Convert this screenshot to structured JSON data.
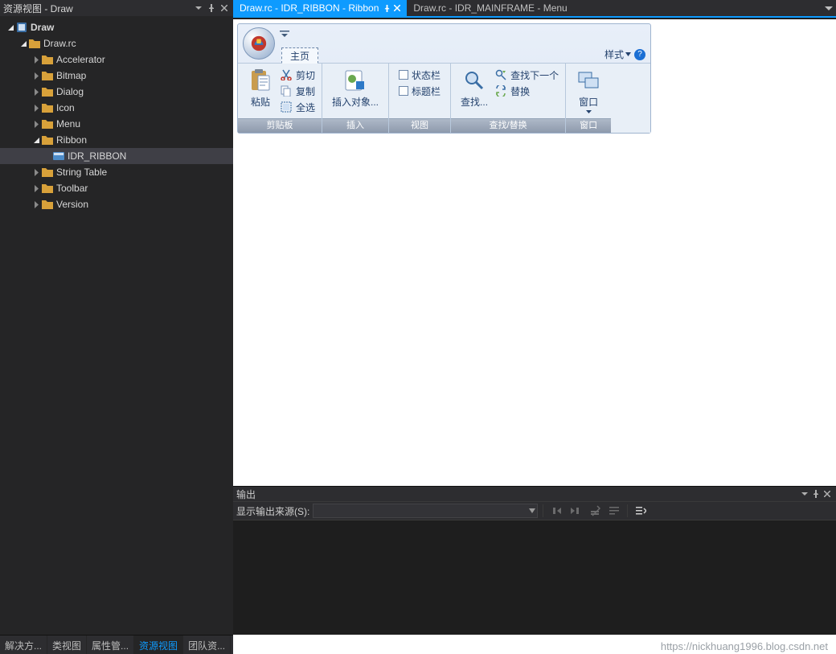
{
  "sidebar": {
    "title": "资源视图 - Draw",
    "tree": {
      "root": "Draw",
      "rc": "Draw.rc",
      "folders": [
        "Accelerator",
        "Bitmap",
        "Dialog",
        "Icon",
        "Menu",
        "Ribbon",
        "String Table",
        "Toolbar",
        "Version"
      ],
      "ribbon_item": "IDR_RIBBON"
    }
  },
  "bottom_tabs": [
    "解决方...",
    "类视图",
    "属性管...",
    "资源视图",
    "团队资..."
  ],
  "doc_tabs": {
    "active": "Draw.rc - IDR_RIBBON - Ribbon",
    "inactive": "Draw.rc - IDR_MAINFRAME - Menu"
  },
  "ribbon": {
    "tab": "主页",
    "style": "样式",
    "groups": {
      "clipboard": {
        "label": "剪贴板",
        "paste": "粘贴",
        "cut": "剪切",
        "copy": "复制",
        "selectall": "全选"
      },
      "insert": {
        "label": "插入",
        "insert_obj": "插入对象..."
      },
      "view": {
        "label": "视图",
        "statusbar": "状态栏",
        "titlebar": "标题栏"
      },
      "find": {
        "label": "查找/替换",
        "find": "查找...",
        "findnext": "查找下一个",
        "replace": "替换"
      },
      "window": {
        "label": "窗口",
        "window": "窗口"
      }
    }
  },
  "output": {
    "title": "输出",
    "source_label": "显示输出来源(S):"
  },
  "watermark": "https://nickhuang1996.blog.csdn.net"
}
